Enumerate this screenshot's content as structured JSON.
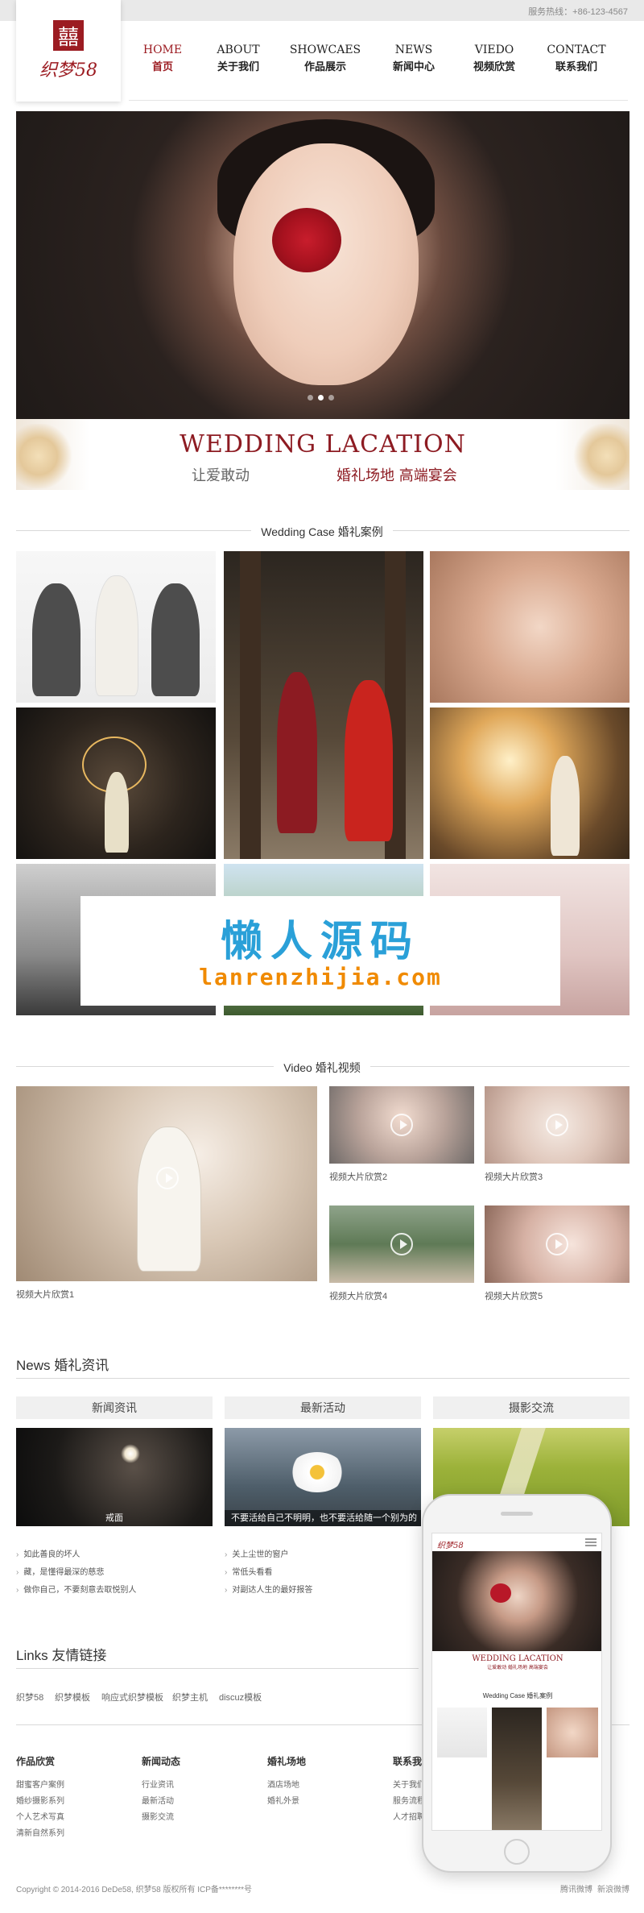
{
  "topbar": {
    "hotline": "服务热线：+86-123-4567"
  },
  "logo": {
    "mark": "囍",
    "brand": "织梦58"
  },
  "nav": [
    {
      "en": "HOME",
      "cn": "首页",
      "active": true
    },
    {
      "en": "ABOUT",
      "cn": "关于我们",
      "active": false
    },
    {
      "en": "SHOWCAES",
      "cn": "作品展示",
      "active": false
    },
    {
      "en": "NEWS",
      "cn": "新闻中心",
      "active": false
    },
    {
      "en": "VIEDO",
      "cn": "视频欣赏",
      "active": false
    },
    {
      "en": "CONTACT",
      "cn": "联系我们",
      "active": false
    }
  ],
  "banner": {
    "title": "WEDDING LACATION",
    "slogan_left": "让爱敢动",
    "slogan_right": "婚礼场地 高端宴会",
    "slide_count": 3,
    "active_slide": 1
  },
  "cases": {
    "title": "Wedding Case 婚礼案例"
  },
  "watermark": {
    "title": "懒人源码",
    "url": "lanrenzhijia.com"
  },
  "video": {
    "title": "Video  婚礼视频",
    "items": [
      {
        "caption": "视频大片欣赏1"
      },
      {
        "caption": "视频大片欣赏2"
      },
      {
        "caption": "视频大片欣赏3"
      },
      {
        "caption": "视频大片欣赏4"
      },
      {
        "caption": "视频大片欣赏5"
      }
    ]
  },
  "news": {
    "title": "News  婚礼资讯",
    "columns": [
      {
        "head": "新闻资讯",
        "img_caption": "戒面",
        "items": [
          "如此善良的坏人",
          "藏，是懂得最深的慈悲",
          "做你自己，不要刻意去取悦别人"
        ]
      },
      {
        "head": "最新活动",
        "img_caption": "不要活给自己不明明，也不要活给随一个别为的",
        "items": [
          "关上尘世的窗户",
          "常低头看看",
          "对副达人生的最好报答"
        ]
      },
      {
        "head": "摄影交流",
        "img_caption": "",
        "items": []
      }
    ]
  },
  "links": {
    "title": "Links  友情链接",
    "items": [
      "织梦58",
      "织梦模板",
      "响应式织梦模板",
      "织梦主机",
      "discuz模板"
    ]
  },
  "footer": {
    "columns": [
      {
        "head": "作品欣赏",
        "items": [
          "甜蜜客户案例",
          "婚纱摄影系列",
          "个人艺术写真",
          "清新自然系列"
        ]
      },
      {
        "head": "新闻动态",
        "items": [
          "行业资讯",
          "最新活动",
          "摄影交流"
        ]
      },
      {
        "head": "婚礼场地",
        "items": [
          "酒店场地",
          "婚礼外景"
        ]
      },
      {
        "head": "联系我们",
        "items": [
          "关于我们",
          "服务流程",
          "人才招聘"
        ]
      }
    ],
    "copyright": "Copyright © 2014-2016 DeDe58, 织梦58 版权所有 ICP备********号",
    "social": [
      "腾讯微博",
      "新浪微博"
    ]
  },
  "phone": {
    "logo": "织梦58",
    "banner_title": "WEDDING LACATION",
    "banner_sub": "让爱敢动   婚礼场地 高端宴会",
    "section": "Wedding Case 婚礼案例"
  }
}
